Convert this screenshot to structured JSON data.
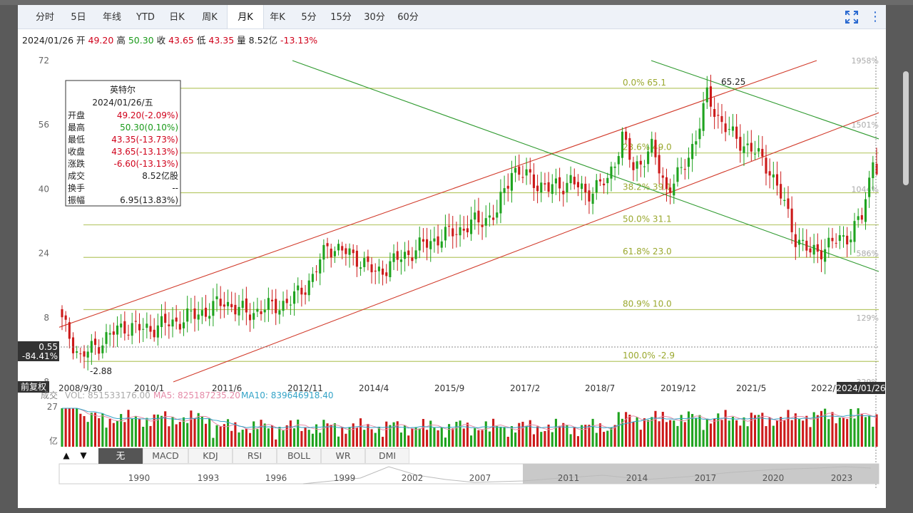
{
  "tabs": [
    {
      "label": "分时",
      "x": 20,
      "w": 36
    },
    {
      "label": "5日",
      "x": 70,
      "w": 30
    },
    {
      "label": "年线",
      "x": 114,
      "w": 36
    },
    {
      "label": "YTD",
      "x": 162,
      "w": 34
    },
    {
      "label": "日K",
      "x": 210,
      "w": 26
    },
    {
      "label": "周K",
      "x": 255,
      "w": 28
    },
    {
      "label": "月K",
      "x": 293,
      "w": 50
    },
    {
      "label": "年K",
      "x": 350,
      "w": 28
    },
    {
      "label": "5分",
      "x": 396,
      "w": 24
    },
    {
      "label": "15分",
      "x": 437,
      "w": 32
    },
    {
      "label": "30分",
      "x": 484,
      "w": 32
    },
    {
      "label": "60分",
      "x": 531,
      "w": 32
    }
  ],
  "active_tab": "月K",
  "info": {
    "date": "2024/01/26",
    "open_label": "开",
    "open": "49.20",
    "high_label": "高",
    "high": "50.30",
    "close_label": "收",
    "close": "43.65",
    "low_label": "低",
    "low": "43.35",
    "vol_label": "量",
    "vol": "8.52亿",
    "chg": "-13.13%"
  },
  "tooltip": {
    "name": "英特尔",
    "date": "2024/01/26/五",
    "rows": [
      {
        "k": "开盘",
        "v": "49.20(-2.09%)",
        "c": "#d0021b"
      },
      {
        "k": "最高",
        "v": "50.30(0.10%)",
        "c": "#1a9a1a"
      },
      {
        "k": "最低",
        "v": "43.35(-13.73%)",
        "c": "#d0021b"
      },
      {
        "k": "收盘",
        "v": "43.65(-13.13%)",
        "c": "#d0021b"
      },
      {
        "k": "涨跌",
        "v": "-6.60(-13.13%)",
        "c": "#d0021b"
      },
      {
        "k": "成交",
        "v": "8.52亿股",
        "c": "#222"
      },
      {
        "k": "换手",
        "v": "--",
        "c": "#222"
      },
      {
        "k": "振幅",
        "v": "6.95(13.83%)",
        "c": "#222"
      }
    ]
  },
  "colors": {
    "up": "#1fa31f",
    "down": "#cc1a1a",
    "fib": "#b8c96a",
    "fib_text": "#9aa82e",
    "channel_red": "#d13a2a",
    "channel_green": "#2f9a2f",
    "ma5": "#e58ba8",
    "ma10": "#34a4c8"
  },
  "chart_data": {
    "type": "candlestick",
    "period": "monthly",
    "y_ticks": [
      72,
      56,
      40,
      24,
      8,
      -8
    ],
    "y_right_ticks": [
      "1958%",
      "1501%",
      "1044%",
      "586%",
      "129%",
      "-329%"
    ],
    "x_ticks": [
      "2008/9/30",
      "2010/1",
      "2011/6",
      "2012/11",
      "2014/4",
      "2015/9",
      "2017/2",
      "2018/7",
      "2019/12",
      "2021/5",
      "2022/10",
      "2024/01/26"
    ],
    "fib_levels": [
      {
        "label": "0.0% 65.1",
        "value": 65.1
      },
      {
        "label": "23.6% 49.0",
        "value": 49.0
      },
      {
        "label": "38.2% 39.1",
        "value": 39.1
      },
      {
        "label": "50.0% 31.1",
        "value": 31.1
      },
      {
        "label": "61.8% 23.0",
        "value": 23.0
      },
      {
        "label": "80.9% 10.0",
        "value": 10.0
      },
      {
        "label": "100.0% -2.9",
        "value": -2.9
      }
    ],
    "annotations": {
      "high": "65.25",
      "low": "-2.88"
    },
    "crosshair": {
      "price": "0.55",
      "pct": "-84.41%"
    },
    "fuquan_label": "前复权",
    "monthly_close_anchors": [
      {
        "t": 0,
        "v": 7
      },
      {
        "t": 5,
        "v": -2
      },
      {
        "t": 12,
        "v": 3
      },
      {
        "t": 17,
        "v": 6
      },
      {
        "t": 22,
        "v": 5
      },
      {
        "t": 31,
        "v": 7
      },
      {
        "t": 40,
        "v": 10
      },
      {
        "t": 44,
        "v": 12
      },
      {
        "t": 50,
        "v": 9
      },
      {
        "t": 54,
        "v": 10
      },
      {
        "t": 62,
        "v": 12
      },
      {
        "t": 68,
        "v": 18
      },
      {
        "t": 72,
        "v": 26
      },
      {
        "t": 80,
        "v": 23
      },
      {
        "t": 85,
        "v": 19
      },
      {
        "t": 92,
        "v": 23
      },
      {
        "t": 100,
        "v": 27
      },
      {
        "t": 108,
        "v": 30
      },
      {
        "t": 118,
        "v": 34
      },
      {
        "t": 122,
        "v": 45
      },
      {
        "t": 126,
        "v": 43
      },
      {
        "t": 132,
        "v": 40
      },
      {
        "t": 138,
        "v": 42
      },
      {
        "t": 142,
        "v": 39
      },
      {
        "t": 148,
        "v": 42
      },
      {
        "t": 152,
        "v": 53
      },
      {
        "t": 155,
        "v": 45
      },
      {
        "t": 160,
        "v": 50
      },
      {
        "t": 164,
        "v": 40
      },
      {
        "t": 168,
        "v": 44
      },
      {
        "t": 172,
        "v": 53
      },
      {
        "t": 175,
        "v": 63
      },
      {
        "t": 178,
        "v": 58
      },
      {
        "t": 182,
        "v": 53
      },
      {
        "t": 187,
        "v": 50
      },
      {
        "t": 192,
        "v": 45
      },
      {
        "t": 196,
        "v": 36
      },
      {
        "t": 199,
        "v": 28
      },
      {
        "t": 203,
        "v": 24
      },
      {
        "t": 208,
        "v": 26
      },
      {
        "t": 214,
        "v": 29
      },
      {
        "t": 217,
        "v": 33
      },
      {
        "t": 219,
        "v": 42
      },
      {
        "t": 220,
        "v": 48
      },
      {
        "t": 221,
        "v": 43.65
      }
    ],
    "volume": {
      "label": "成交",
      "vol_text": "VOL: 851533176.00",
      "ma5_text": "MA5: 825187235.20",
      "ma10_text": "MA10: 839646918.40",
      "y_top": "27",
      "unit": "亿"
    }
  },
  "indicators": [
    "无",
    "MACD",
    "KDJ",
    "RSI",
    "BOLL",
    "WR",
    "DMI"
  ],
  "active_indicator": "无",
  "nav_arrows": [
    "▲",
    "▼"
  ],
  "overview_years": [
    "1990",
    "1993",
    "1996",
    "1999",
    "2002",
    "2007",
    "2011",
    "2014",
    "2017",
    "2020",
    "2023"
  ]
}
